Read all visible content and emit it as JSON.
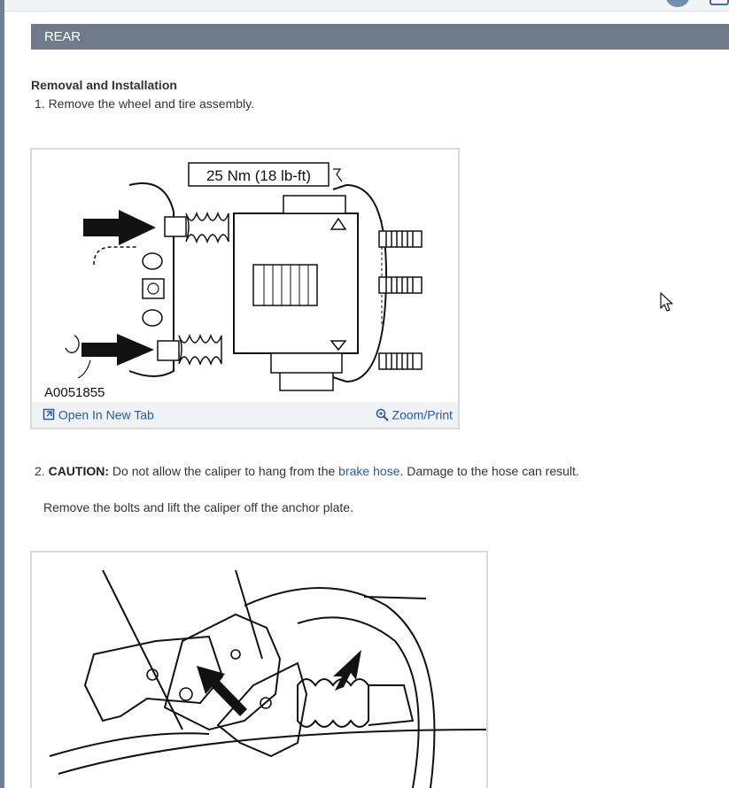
{
  "section": {
    "title": "REAR"
  },
  "subheading": "Removal and Installation",
  "steps": {
    "step1": "1. Remove the wheel and tire assembly.",
    "step2_number": "2.",
    "step2_caution": "CAUTION:",
    "step2_text_before": "Do not allow the caliper to hang from the",
    "step2_link": "brake hose",
    "step2_text_after": ". Damage to the hose can result.",
    "step2_remove": "Remove the bolts and lift the caliper off the anchor plate."
  },
  "figure1": {
    "torque_label": "25 Nm (18 lb-ft)",
    "figure_id": "A0051855",
    "open_tab_label": "Open In New Tab",
    "zoom_label": "Zoom/Print"
  },
  "icons": [
    "open-in-new-tab-icon",
    "zoom-icon",
    "mouse-cursor-icon"
  ],
  "colors": {
    "section_bar": "#6f7b8b",
    "link": "#2a5b9a",
    "footer_bg": "#f0f2f5"
  }
}
